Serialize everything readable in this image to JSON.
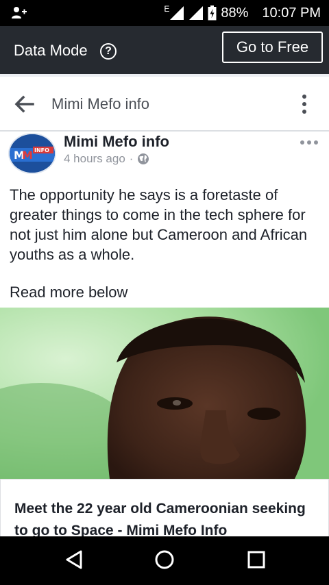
{
  "status_bar": {
    "network_label": "E",
    "battery_percent": "88%",
    "time": "10:07 PM",
    "icons": [
      "add-user-icon",
      "signal-icon",
      "signal-icon",
      "battery-icon"
    ]
  },
  "data_bar": {
    "label": "Data Mode",
    "help_glyph": "?",
    "go_free_label": "Go to Free"
  },
  "header": {
    "title": "Mimi Mefo info"
  },
  "post": {
    "author": "Mimi Mefo info",
    "time": "4 hours ago",
    "separator": "·",
    "body": "The opportunity he says is a foretaste of greater things to come in the tech sphere for not just him alone but Cameroon and African youths as a whole.",
    "read_more": "Read more below",
    "avatar_logo_text": "INFO"
  },
  "link_card": {
    "title": "Meet the 22 year old Cameroonian seeking to go to Space - Mimi Mefo Info"
  },
  "colors": {
    "status_bar": "#000000",
    "data_bar": "#262a30",
    "text_primary": "#1d2129",
    "text_secondary": "#90949c",
    "header_title": "#4b4f56"
  }
}
